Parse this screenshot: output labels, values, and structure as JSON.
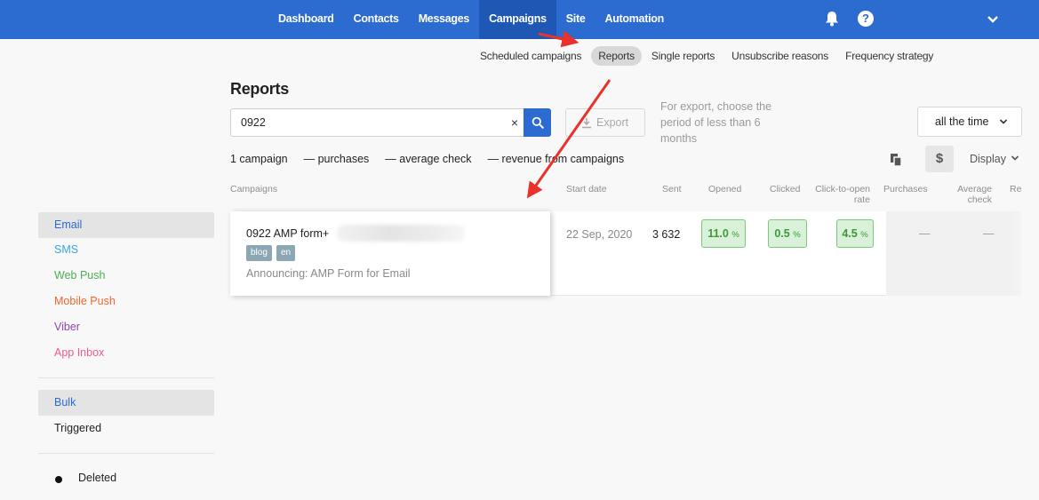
{
  "nav": {
    "items": [
      "Dashboard",
      "Contacts",
      "Messages",
      "Campaigns",
      "Site",
      "Automation"
    ],
    "active_index": 3
  },
  "subnav": {
    "items": [
      "Scheduled campaigns",
      "Reports",
      "Single reports",
      "Unsubscribe reasons",
      "Frequency strategy"
    ],
    "active_index": 1
  },
  "page": {
    "title": "Reports"
  },
  "search": {
    "value": "0922",
    "clear_icon": "×"
  },
  "export": {
    "label": "Export",
    "note": "For export, choose the period of less than 6 months"
  },
  "period": {
    "label": "all the time"
  },
  "summary": {
    "campaigns": "1 campaign",
    "purchases": "— purchases",
    "average_check": "— average check",
    "revenue": "— revenue from campaigns"
  },
  "toolbar": {
    "dollar": "$",
    "display_label": "Display"
  },
  "table": {
    "headers": {
      "campaigns": "Campaigns",
      "start_date": "Start date",
      "sent": "Sent",
      "opened": "Opened",
      "clicked": "Clicked",
      "cto_1": "Click-to-open",
      "cto_2": "rate",
      "purchases": "Purchases",
      "avg_1": "Average",
      "avg_2": "check",
      "revenue": "Re"
    },
    "rows": [
      {
        "name": "0922 AMP form+",
        "tags": [
          "blog",
          "en"
        ],
        "subject": "Announcing: AMP Form for Email",
        "start_date": "22 Sep, 2020",
        "sent": "3 632",
        "opened": "11.0",
        "clicked": "0.5",
        "cto": "4.5",
        "pct": "%",
        "purchases": "—",
        "average_check": "—"
      }
    ]
  },
  "sidebar": {
    "channels": [
      {
        "label": "Email",
        "color": "#2c6bd0"
      },
      {
        "label": "SMS",
        "color": "#34a8e0"
      },
      {
        "label": "Web Push",
        "color": "#4caf50"
      },
      {
        "label": "Mobile Push",
        "color": "#f06530"
      },
      {
        "label": "Viber",
        "color": "#8e44ad"
      },
      {
        "label": "App Inbox",
        "color": "#f05a8c"
      }
    ],
    "types": [
      {
        "label": "Bulk",
        "color": "#2c6bd0"
      },
      {
        "label": "Triggered",
        "color": "#222222"
      }
    ],
    "deleted_label": "Deleted"
  },
  "colors": {
    "brand": "#2c6bd0",
    "annotation": "#e8322a",
    "success": "#3a9a3a"
  }
}
